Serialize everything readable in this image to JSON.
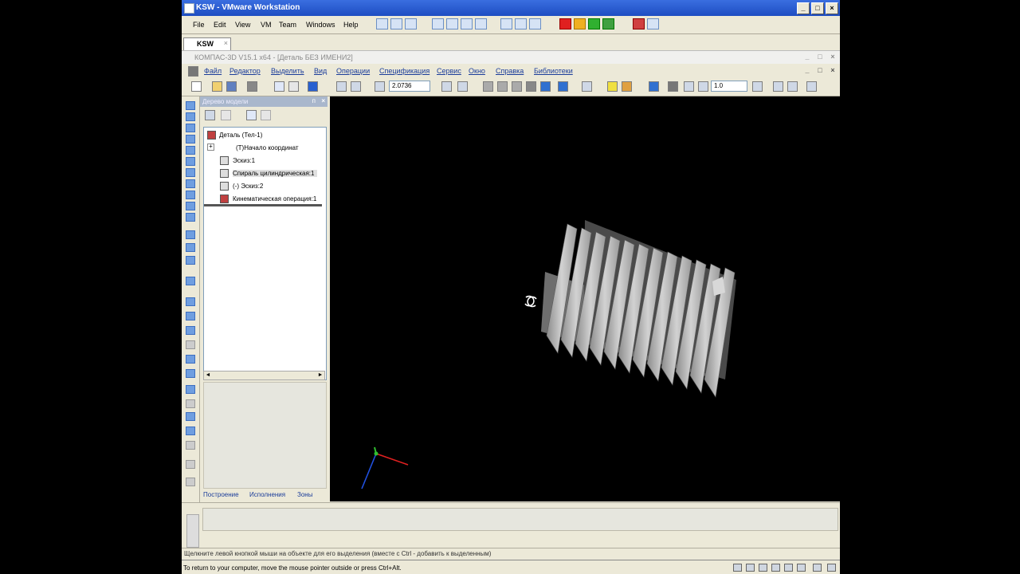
{
  "vmware": {
    "title": "KSW - VMware Workstation",
    "menu": [
      "File",
      "Edit",
      "View",
      "VM",
      "Team",
      "Windows",
      "Help"
    ],
    "tab_label": "KSW",
    "tab_close": "×",
    "status_text": "To return to your computer, move the mouse pointer outside or press Ctrl+Alt."
  },
  "window_buttons": {
    "minimize": "_",
    "maximize": "□",
    "close": "×"
  },
  "kompas": {
    "title": "КОМПАС-3D V15.1 x64 - [Деталь БЕЗ ИМЕНИ2]",
    "menu": [
      "Файл",
      "Редактор",
      "Выделить",
      "Вид",
      "Операции",
      "Спецификация",
      "Сервис",
      "Окно",
      "Справка",
      "Библиотеки"
    ],
    "zoom_value": "2.0736",
    "step_value": "1.0",
    "status_text": "Щелкните левой кнопкой мыши на объекте для его выделения (вместе с Ctrl - добавить к выделенным)"
  },
  "tree_panel": {
    "title": "Дерево модели",
    "pin": "ᴨ",
    "close": "×",
    "items": [
      {
        "label": "Деталь (Тел-1)"
      },
      {
        "label": "(Т)Начало координат",
        "expander": "+"
      },
      {
        "label": "Эскиз:1"
      },
      {
        "label": "Спираль цилиндрическая:1"
      },
      {
        "label": "(-) Эскиз:2"
      },
      {
        "label": "Кинематическая операция:1"
      }
    ],
    "scroll_left": "◄",
    "scroll_right": "►",
    "bottom_tabs": [
      "Построение",
      "Исполнения",
      "Зоны"
    ]
  },
  "icons": {
    "rotate_cursor": "rotate-cursor-icon",
    "axis_triad": "axis-triad-icon",
    "part": "part-icon",
    "sketch": "sketch-icon",
    "spiral": "spiral-icon",
    "sweep": "sweep-operation-icon"
  },
  "colors": {
    "vm_title_bar": "#2a5fd6",
    "kompas_link_text": "#1a3c9a",
    "viewport_bg": "#000000",
    "model_light": "#c8c8c8",
    "model_dark": "#6e6e6e",
    "axis_x": "#e02020",
    "axis_y": "#30c030",
    "axis_z": "#2050e0"
  }
}
